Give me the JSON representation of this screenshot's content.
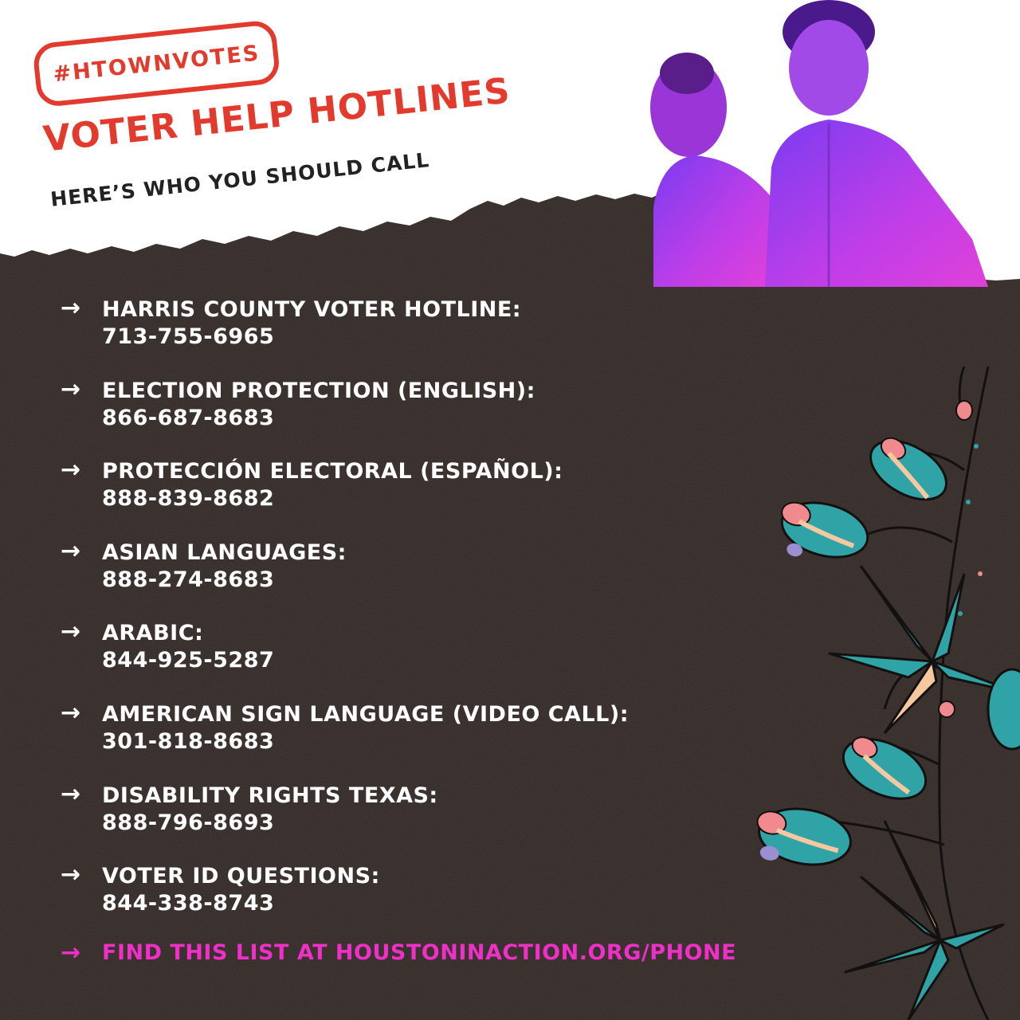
{
  "hashtag": "#HTOWNVOTES",
  "title": "VOTER HELP HOTLINES",
  "subtitle": "HERE’S WHO YOU SHOULD CALL",
  "arrow_glyph": "→",
  "hotlines": [
    {
      "label": "HARRIS COUNTY VOTER HOTLINE:",
      "phone": "713-755-6965"
    },
    {
      "label": "ELECTION PROTECTION (ENGLISH):",
      "phone": "866-687-8683"
    },
    {
      "label": "PROTECCIÓN ELECTORAL (ESPAÑOL):",
      "phone": "888-839-8682"
    },
    {
      "label": "ASIAN LANGUAGES:",
      "phone": "888-274-8683"
    },
    {
      "label": "ARABIC:",
      "phone": "844-925-5287"
    },
    {
      "label": "AMERICAN SIGN LANGUAGE (VIDEO CALL):",
      "phone": "301-818-8683"
    },
    {
      "label": "DISABILITY RIGHTS TEXAS:",
      "phone": "888-796-8693"
    },
    {
      "label": "VOTER ID QUESTIONS:",
      "phone": "844-338-8743"
    }
  ],
  "footer": "FIND THIS LIST AT HOUSTONINACTION.ORG/PHONE",
  "colors": {
    "accent_red": "#e23a2c",
    "paper_dark": "#2e2623",
    "text_white": "#ffffff",
    "link_magenta": "#f02ec8",
    "photo_tint": "#b83cf0",
    "flower_teal": "#2fa3a6",
    "flower_pink": "#f08a8f",
    "flower_lavender": "#9a8fd0"
  }
}
